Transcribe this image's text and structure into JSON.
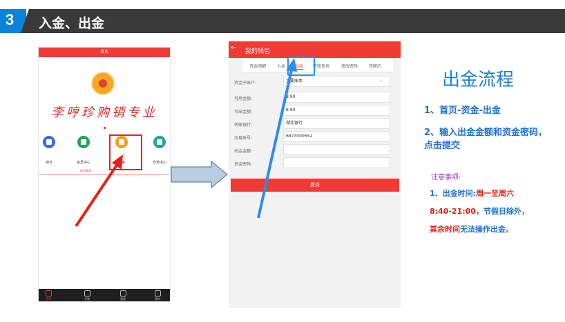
{
  "header": {
    "number": "3",
    "title": "入金、出金"
  },
  "phone1": {
    "top_title": "首页",
    "brand": "李哼珍购销专业",
    "icons": [
      {
        "label": "持仓",
        "color": "#3a6fd8",
        "icon": "chart-icon"
      },
      {
        "label": "会员中心",
        "color": "#23a454",
        "icon": "member-icon"
      },
      {
        "label": "资金",
        "color": "#f0a020",
        "icon": "money-bag-icon"
      },
      {
        "label": "仓单中心",
        "color": "#23a88a",
        "icon": "warehouse-icon"
      }
    ],
    "note": "退出登录",
    "tabbar": [
      "首页",
      "仓储",
      "我要",
      "我的"
    ]
  },
  "phone2": {
    "back": "←",
    "title": "我的钱包",
    "tabs": [
      "资金明细",
      "入金",
      "出金",
      "转账查询",
      "修改密码",
      "签解约"
    ],
    "fields": [
      {
        "label": "资金子账户:",
        "value": "主要账本"
      },
      {
        "label": "可用金额:",
        "value": "8.90"
      },
      {
        "label": "可出金额:",
        "value": "8.90"
      },
      {
        "label": "转账银行:",
        "value": "湖北银行"
      },
      {
        "label": "交易账号:",
        "value": "6873000652"
      },
      {
        "label": "出金金额:",
        "value": ""
      },
      {
        "label": "资金密码:",
        "value": ""
      }
    ],
    "submit": "提交"
  },
  "right": {
    "title": "出金流程",
    "step1": "1、首页-资金-出金",
    "step2": "2、输入出金金额和资金密码，点击提交",
    "notes_title": "注意事项:",
    "note_a": "1、出金时间:",
    "note_b": "周一至周六",
    "note_c": "8:40-21:00",
    "note_d": "，节假日除外，",
    "note_e": "其余时间",
    "note_f": "无法操作出金。"
  },
  "colors": {
    "accent": "#ef3b34",
    "blue": "#1e6fd0",
    "header_bg": "#3a3a3a",
    "badge": "#0b84d8"
  }
}
